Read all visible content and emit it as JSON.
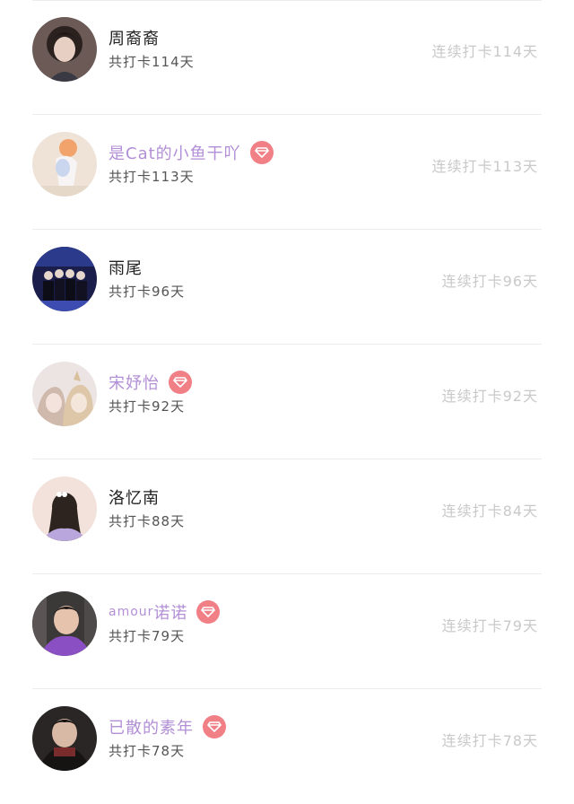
{
  "list": {
    "items": [
      {
        "name": "周裔裔",
        "name_latin": "",
        "vip": false,
        "total": "共打卡114天",
        "streak": "连续打卡114天"
      },
      {
        "name": "是Cat的小鱼干吖",
        "name_latin": "",
        "vip": true,
        "total": "共打卡113天",
        "streak": "连续打卡113天"
      },
      {
        "name": "雨尾",
        "name_latin": "",
        "vip": false,
        "total": "共打卡96天",
        "streak": "连续打卡96天"
      },
      {
        "name": "宋妤怡",
        "name_latin": "",
        "vip": true,
        "total": "共打卡92天",
        "streak": "连续打卡92天"
      },
      {
        "name": "洛忆南",
        "name_latin": "",
        "vip": false,
        "total": "共打卡88天",
        "streak": "连续打卡84天"
      },
      {
        "name": "诺诺",
        "name_latin": "amour",
        "vip": true,
        "total": "共打卡79天",
        "streak": "连续打卡79天"
      },
      {
        "name": "已散的素年",
        "name_latin": "",
        "vip": true,
        "total": "共打卡78天",
        "streak": "连续打卡78天"
      }
    ]
  },
  "icons": {
    "vip_badge": "diamond-icon",
    "avatar": "user-avatar"
  },
  "colors": {
    "vip_name": "#b28fd6",
    "vip_badge_bg": "#f07f86",
    "streak_text": "#c9c9c9",
    "name_text": "#222222",
    "divider": "#ececec"
  }
}
